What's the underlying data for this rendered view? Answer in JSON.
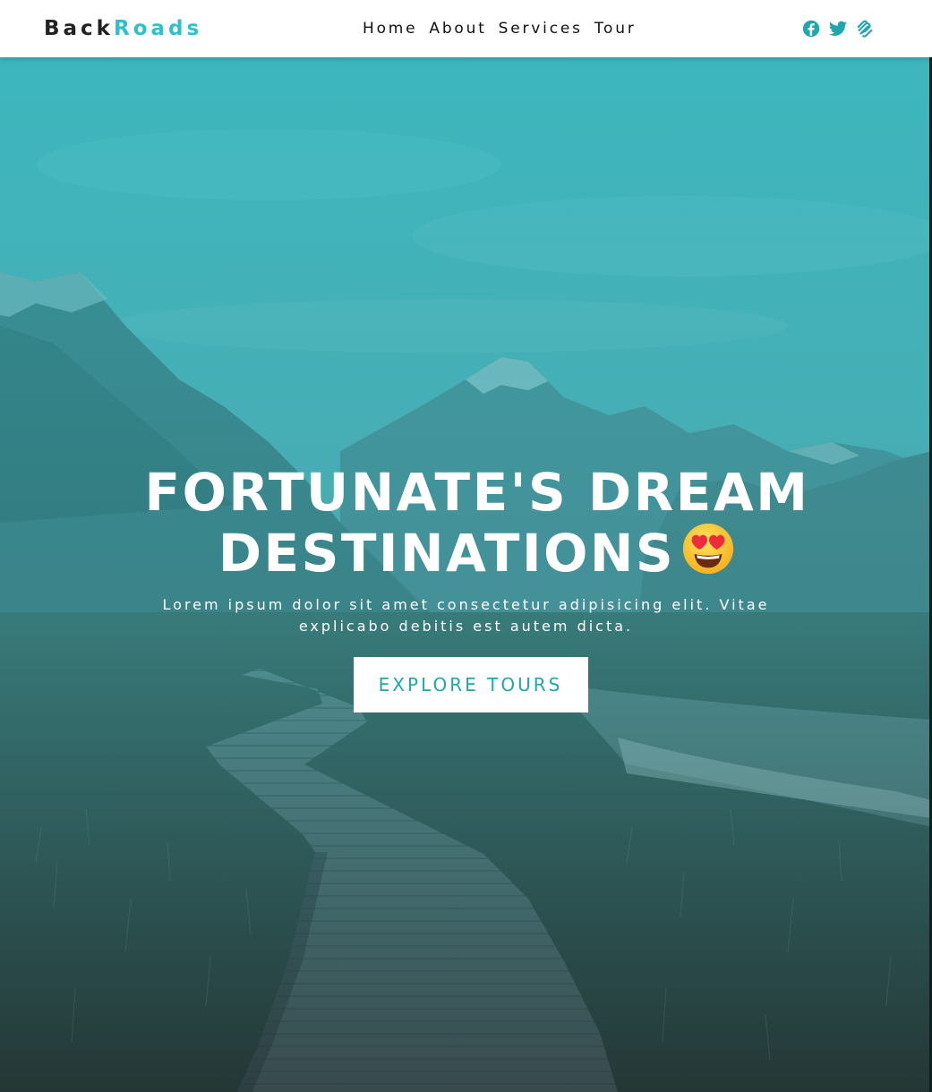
{
  "brand": {
    "part1": "Back",
    "part2": "Roads",
    "accent_color": "#2fc1c8"
  },
  "nav": {
    "links": [
      {
        "label": "Home"
      },
      {
        "label": "About"
      },
      {
        "label": "Services"
      },
      {
        "label": "Tour"
      }
    ],
    "social_icons": [
      "facebook-icon",
      "twitter-icon",
      "squarespace-icon"
    ]
  },
  "hero": {
    "title": "Fortunate's Dream Destinations",
    "emoji": "heart-eyes-emoji",
    "subtitle": "Lorem ipsum dolor sit amet consectetur adipisicing elit. Vitae explicabo debitis est autem dicta.",
    "button_label": "Explore Tours",
    "overlay_color": "#2fb8bf"
  }
}
